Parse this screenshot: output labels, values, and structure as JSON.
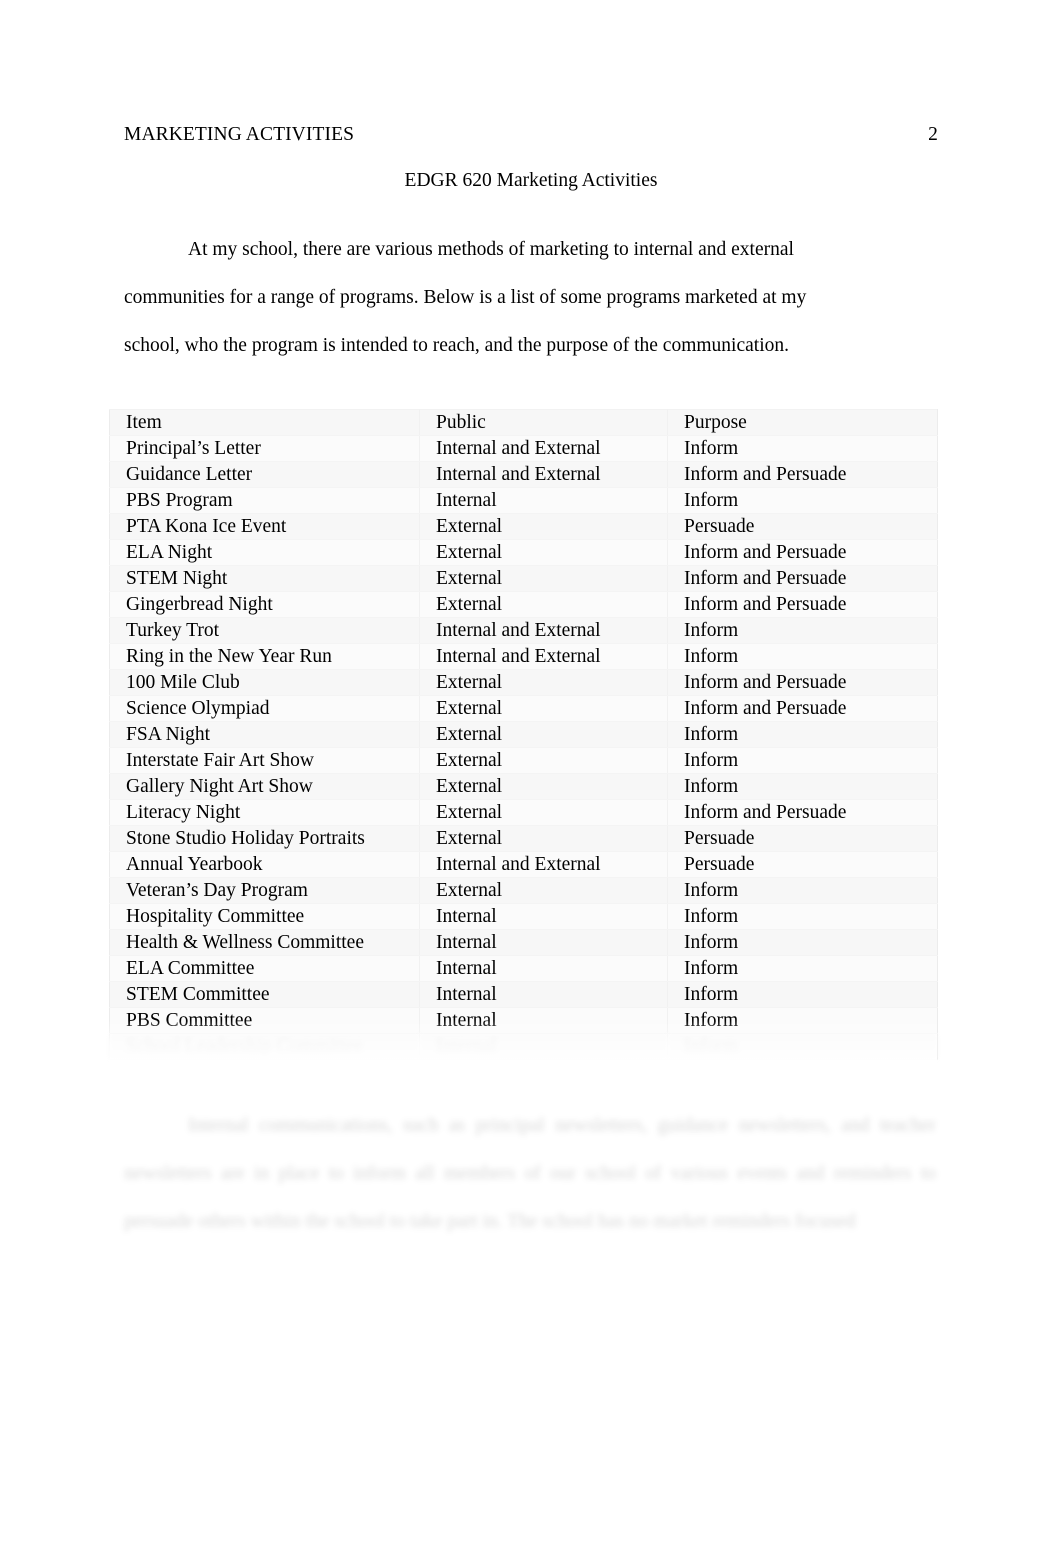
{
  "running_head": {
    "title": "MARKETING ACTIVITIES",
    "page_number": "2"
  },
  "document": {
    "title": "EDGR 620 Marketing Activities",
    "intro_paragraph": "At my school, there are various methods of marketing to internal and external communities for a range of programs. Below is a list of some programs marketed at my school, who the program is intended to reach, and the purpose of the communication.",
    "trailing_paragraph_obscured": "Internal communications, such as principal newsletters, guidance newsletters, and teacher newsletters are in place to inform all members of our school of various events and reminders to persuade others within the school to take part in. The school has no market reminders focused"
  },
  "table": {
    "columns": [
      "Item",
      "Public",
      "Purpose"
    ],
    "rows": [
      {
        "item": "Principal’s Letter",
        "public": "Internal and External",
        "purpose": "Inform",
        "faded": false
      },
      {
        "item": "Guidance Letter",
        "public": "Internal and External",
        "purpose": "Inform and Persuade",
        "faded": false
      },
      {
        "item": "PBS Program",
        "public": "Internal",
        "purpose": "Inform",
        "faded": false
      },
      {
        "item": "PTA Kona Ice Event",
        "public": "External",
        "purpose": "Persuade",
        "faded": false
      },
      {
        "item": "ELA Night",
        "public": "External",
        "purpose": "Inform and Persuade",
        "faded": false
      },
      {
        "item": "STEM Night",
        "public": "External",
        "purpose": "Inform and Persuade",
        "faded": false
      },
      {
        "item": "Gingerbread Night",
        "public": "External",
        "purpose": "Inform and Persuade",
        "faded": false
      },
      {
        "item": "Turkey Trot",
        "public": "Internal and External",
        "purpose": "Inform",
        "faded": false
      },
      {
        "item": "Ring in the New Year Run",
        "public": "Internal and External",
        "purpose": "Inform",
        "faded": false
      },
      {
        "item": "100 Mile Club",
        "public": "External",
        "purpose": "Inform and Persuade",
        "faded": false
      },
      {
        "item": "Science Olympiad",
        "public": "External",
        "purpose": "Inform and Persuade",
        "faded": false
      },
      {
        "item": "FSA Night",
        "public": "External",
        "purpose": "Inform",
        "faded": false
      },
      {
        "item": "Interstate Fair Art Show",
        "public": "External",
        "purpose": "Inform",
        "faded": false
      },
      {
        "item": "Gallery Night Art Show",
        "public": "External",
        "purpose": "Inform",
        "faded": false
      },
      {
        "item": "Literacy Night",
        "public": "External",
        "purpose": "Inform and Persuade",
        "faded": false
      },
      {
        "item": "Stone Studio Holiday Portraits",
        "public": "External",
        "purpose": "Persuade",
        "faded": false
      },
      {
        "item": "Annual Yearbook",
        "public": "Internal and External",
        "purpose": "Persuade",
        "faded": false
      },
      {
        "item": "Veteran’s Day Program",
        "public": "External",
        "purpose": "Inform",
        "faded": false
      },
      {
        "item": "Hospitality Committee",
        "public": "Internal",
        "purpose": "Inform",
        "faded": false
      },
      {
        "item": "Health & Wellness Committee",
        "public": "Internal",
        "purpose": "Inform",
        "faded": false
      },
      {
        "item": "ELA Committee",
        "public": "Internal",
        "purpose": "Inform",
        "faded": false
      },
      {
        "item": "STEM Committee",
        "public": "Internal",
        "purpose": "Inform",
        "faded": false
      },
      {
        "item": "PBS Committee",
        "public": "Internal",
        "purpose": "Inform",
        "faded": false
      },
      {
        "item": "School Leadership Committee",
        "public": "Internal",
        "purpose": "Inform",
        "faded": true
      }
    ]
  }
}
